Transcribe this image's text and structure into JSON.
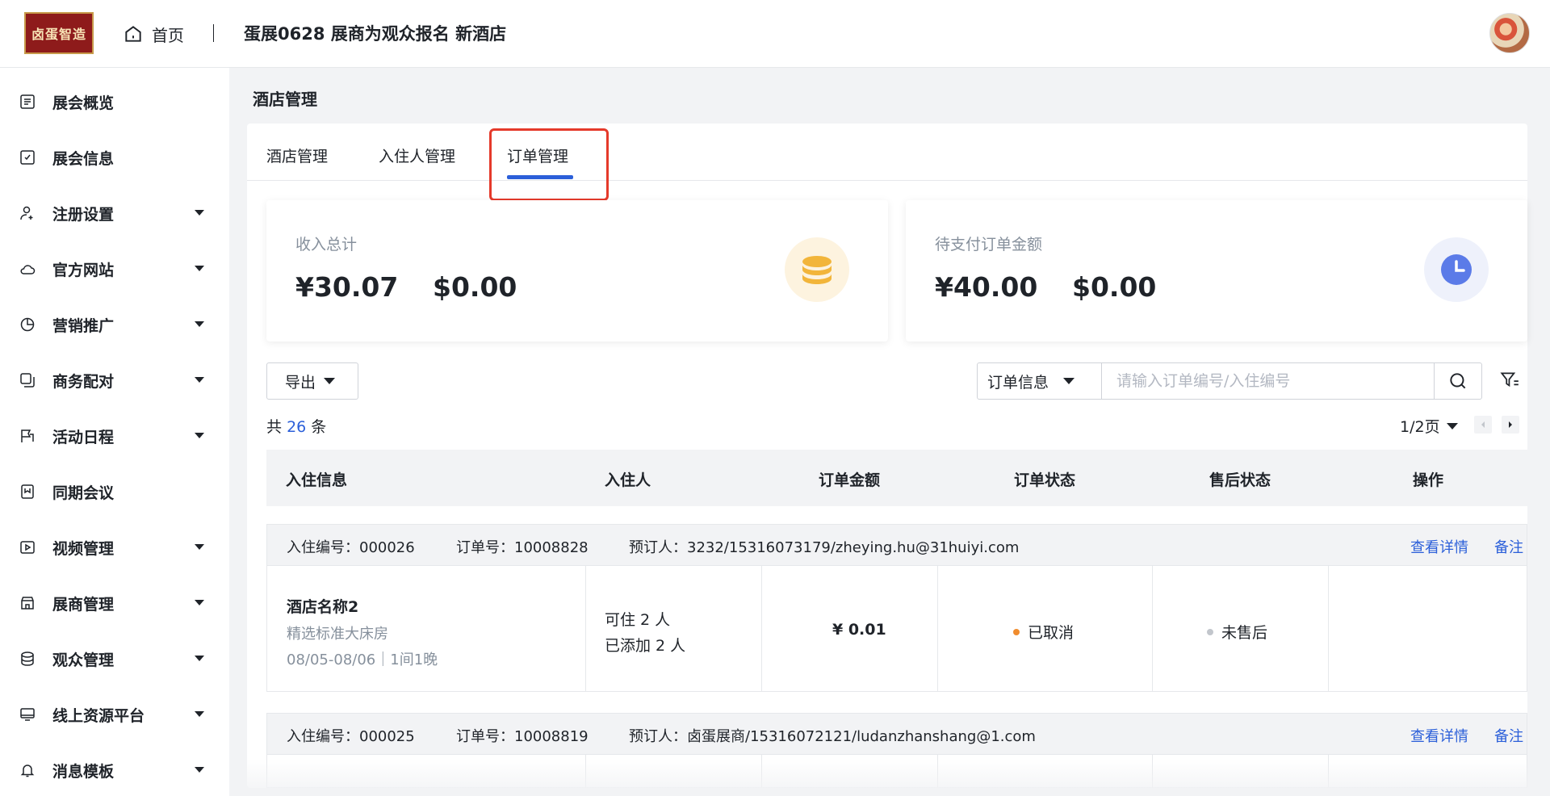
{
  "header": {
    "logo_text": "卤蛋智造",
    "home_label": "首页",
    "title": "蛋展0628 展商为观众报名 新酒店"
  },
  "sidebar": {
    "items": [
      {
        "label": "展会概览",
        "icon": "overview-icon",
        "has_caret": false
      },
      {
        "label": "展会信息",
        "icon": "edit-doc-icon",
        "has_caret": false
      },
      {
        "label": "注册设置",
        "icon": "user-add-icon",
        "has_caret": true
      },
      {
        "label": "官方网站",
        "icon": "cloud-icon",
        "has_caret": true
      },
      {
        "label": "营销推广",
        "icon": "pie-icon",
        "has_caret": true
      },
      {
        "label": "商务配对",
        "icon": "copy-icon",
        "has_caret": true
      },
      {
        "label": "活动日程",
        "icon": "flag-icon",
        "has_caret": true
      },
      {
        "label": "同期会议",
        "icon": "bookmark-icon",
        "has_caret": false
      },
      {
        "label": "视频管理",
        "icon": "video-icon",
        "has_caret": true
      },
      {
        "label": "展商管理",
        "icon": "store-icon",
        "has_caret": true
      },
      {
        "label": "观众管理",
        "icon": "layers-icon",
        "has_caret": true
      },
      {
        "label": "线上资源平台",
        "icon": "monitor-icon",
        "has_caret": true
      },
      {
        "label": "消息模板",
        "icon": "bell-icon",
        "has_caret": true
      }
    ]
  },
  "main": {
    "page_title": "酒店管理",
    "tabs": [
      {
        "label": "酒店管理",
        "active": false
      },
      {
        "label": "入住人管理",
        "active": false
      },
      {
        "label": "订单管理",
        "active": true
      }
    ],
    "stats": [
      {
        "label": "收入总计",
        "cny": "¥30.07",
        "usd": "$0.00",
        "icon": "coins-icon",
        "icon_bg": "#fdf3df",
        "icon_color": "#f2b53a"
      },
      {
        "label": "待支付订单金额",
        "cny": "¥40.00",
        "usd": "$0.00",
        "icon": "clock-icon",
        "icon_bg": "#eef1fb",
        "icon_color": "#5b7be8"
      }
    ],
    "toolbar": {
      "export_label": "导出",
      "search_select": "订单信息",
      "search_placeholder": "请输入订单编号/入住编号"
    },
    "total_prefix": "共",
    "total_count": "26",
    "total_suffix": "条",
    "pager": "1/2页",
    "table": {
      "headers": [
        "入住信息",
        "入住人",
        "订单金额",
        "订单状态",
        "售后状态",
        "操作"
      ],
      "orders": [
        {
          "checkin_no": "入住编号：000026",
          "order_no": "订单号：10008828",
          "booker": "预订人：3232/15316073179/zheying.hu@31huiyi.com",
          "hotel": "酒店名称2",
          "room": "精选标准大床房",
          "dates": "08/05-08/06｜1间1晚",
          "capacity": "可住 2 人",
          "added": "已添加 2 人",
          "amount": "¥ 0.01",
          "status": "已取消",
          "status_color": "#f08c2e",
          "after_sale": "未售后",
          "after_color": "#c2c6cc",
          "actions": [
            "查看详情",
            "备注"
          ]
        },
        {
          "checkin_no": "入住编号：000025",
          "order_no": "订单号：10008819",
          "booker": "预订人：卤蛋展商/15316072121/ludanzhanshang@1.com",
          "actions": [
            "查看详情",
            "备注"
          ]
        }
      ]
    }
  },
  "colors": {
    "accent": "#2b5fd9",
    "highlight": "#e53a2b"
  }
}
